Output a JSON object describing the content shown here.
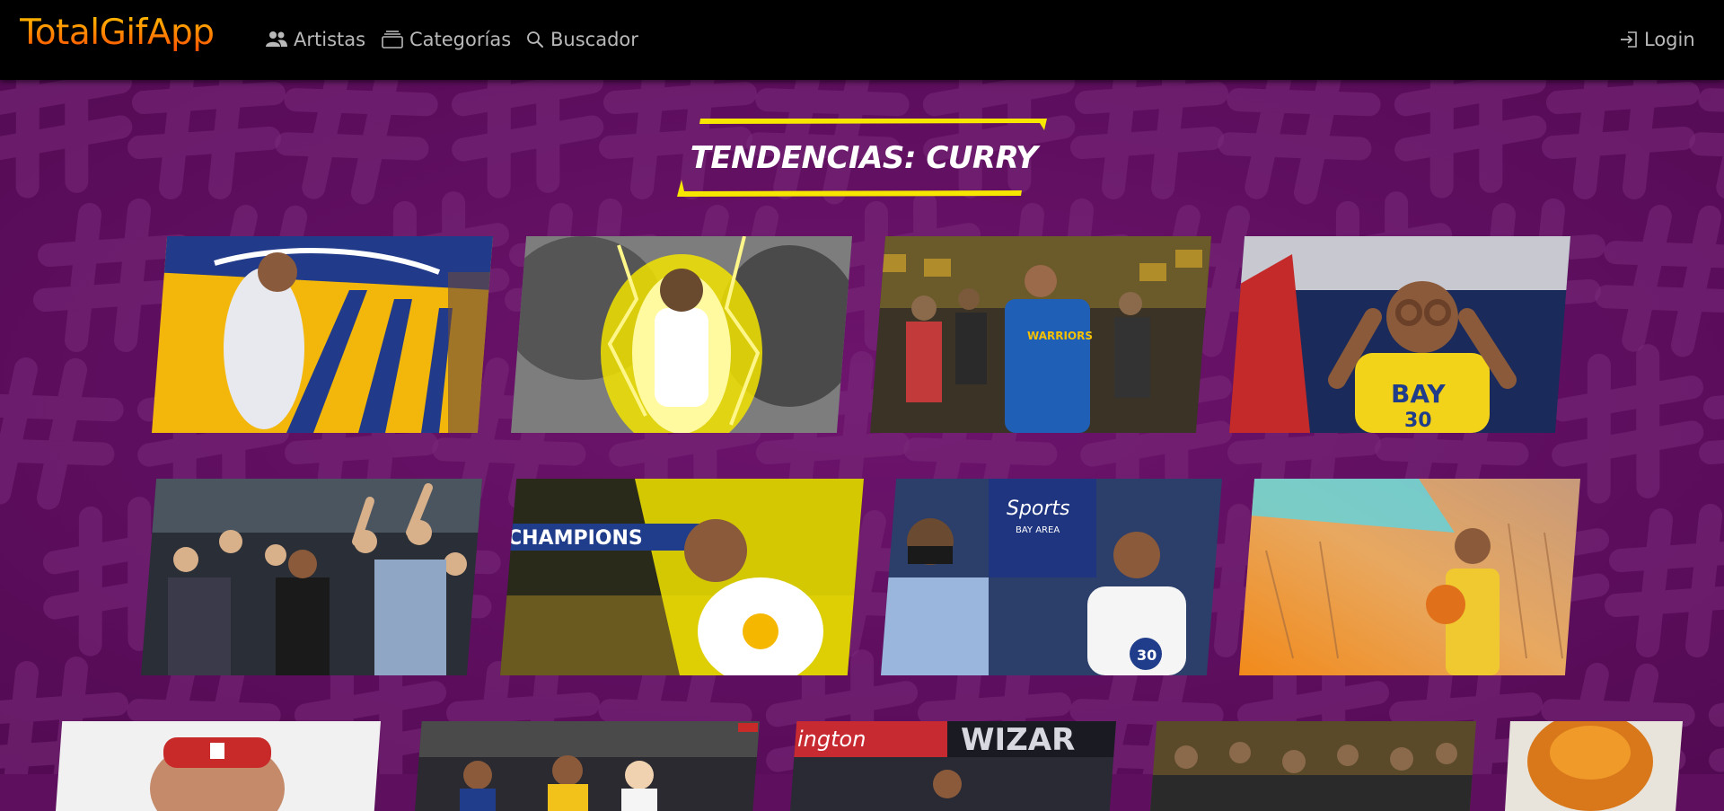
{
  "app": {
    "title": "TotalGifApp"
  },
  "nav": {
    "items": [
      {
        "label": "Artistas",
        "icon": "users-icon"
      },
      {
        "label": "Categorías",
        "icon": "categories-icon"
      },
      {
        "label": "Buscador",
        "icon": "search-icon"
      }
    ],
    "login": {
      "label": "Login",
      "icon": "login-icon"
    }
  },
  "section": {
    "title": "TENDENCIAS: CURRY"
  },
  "colors": {
    "background": "#5e0f5e",
    "navbar": "#000000",
    "accent_yellow": "#f6e600",
    "brand_orange": "#ff7a00",
    "nav_text": "#b9b9b9"
  },
  "gifs": [
    {
      "id": "gif-1",
      "theme": "court-warriors-logo"
    },
    {
      "id": "gif-2",
      "theme": "lightning-power"
    },
    {
      "id": "gif-3",
      "theme": "bench-crowd"
    },
    {
      "id": "gif-4",
      "theme": "goggles-gesture"
    },
    {
      "id": "gif-5",
      "theme": "crowd-celebration"
    },
    {
      "id": "gif-6",
      "theme": "champions-lightning"
    },
    {
      "id": "gif-7",
      "theme": "sports-bay-area"
    },
    {
      "id": "gif-8",
      "theme": "illustration-laser-eyes"
    },
    {
      "id": "gif-9",
      "theme": "headband-portrait"
    },
    {
      "id": "gif-10",
      "theme": "bench-players"
    },
    {
      "id": "gif-11",
      "theme": "wizards-arena"
    },
    {
      "id": "gif-12",
      "theme": "crowd-stands"
    },
    {
      "id": "gif-13",
      "theme": "orange-ball"
    }
  ]
}
